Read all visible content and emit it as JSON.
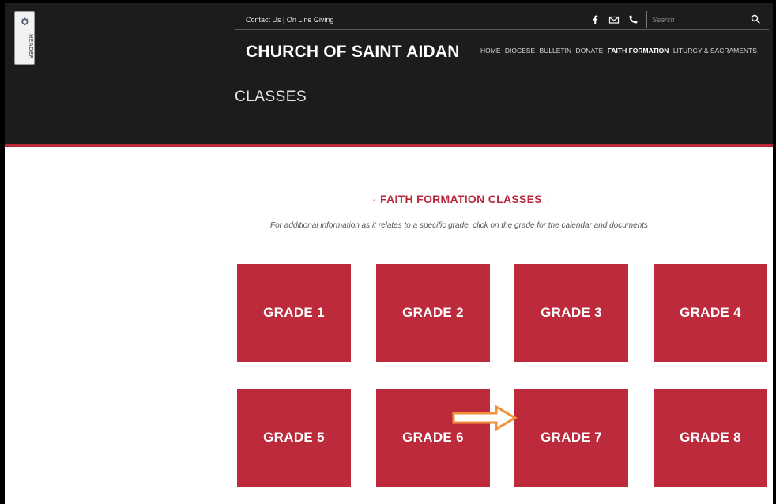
{
  "header": {
    "tab_label": "HEADER",
    "contact_link": "Contact Us",
    "separator": "|",
    "giving_link": "On Line Giving",
    "search_placeholder": "Search",
    "site_title": "CHURCH OF SAINT AIDAN",
    "nav": [
      {
        "label": "HOME",
        "active": false
      },
      {
        "label": "DIOCESE",
        "active": false
      },
      {
        "label": "BULLETIN",
        "active": false
      },
      {
        "label": "DONATE",
        "active": false
      },
      {
        "label": "FAITH FORMATION",
        "active": true
      },
      {
        "label": "LITURGY & SACRAMENTS",
        "active": false
      }
    ],
    "page_heading": "CLASSES"
  },
  "main": {
    "section_title": "FAITH FORMATION CLASSES",
    "title_dot": "·",
    "subtitle": "For additional information as it relates to a specific grade, click on the grade for the calendar and documents",
    "grades": [
      "GRADE 1",
      "GRADE 2",
      "GRADE 3",
      "GRADE 4",
      "GRADE 5",
      "GRADE 6",
      "GRADE 7",
      "GRADE 8"
    ]
  },
  "icons": [
    "gear-icon",
    "facebook-icon",
    "email-icon",
    "phone-icon",
    "search-icon",
    "arrow-right-icon"
  ],
  "colors": {
    "accent": "#bc2a3c",
    "header_bg": "#1c1c1c",
    "arrow": "#f0913a"
  }
}
